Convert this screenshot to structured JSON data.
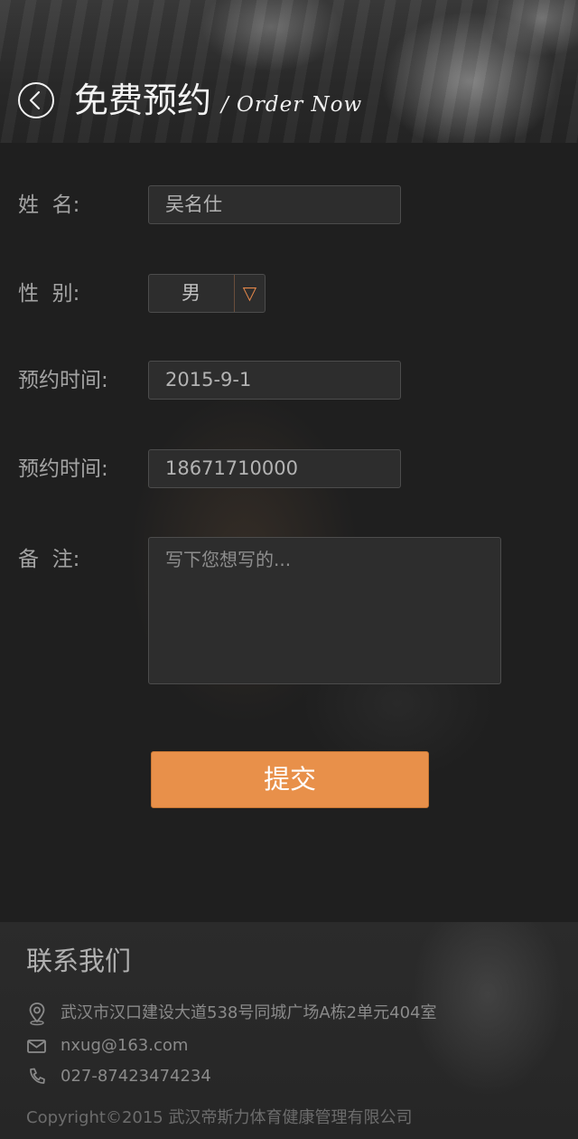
{
  "header": {
    "title": "免费预约",
    "subtitle": "/ Order Now"
  },
  "form": {
    "name": {
      "label": "姓  名:",
      "value": "吴名仕"
    },
    "gender": {
      "label": "性  别:",
      "value": "男",
      "toggle_glyph": "▽"
    },
    "date": {
      "label": "预约时间:",
      "value": "2015-9-1"
    },
    "phone": {
      "label": "预约时间:",
      "value": "18671710000"
    },
    "notes": {
      "label": "备  注:",
      "placeholder": "写下您想写的..."
    },
    "submit_label": "提交"
  },
  "footer": {
    "title": "联系我们",
    "address": "武汉市汉口建设大道538号同城广场A栋2单元404室",
    "email": "nxug@163.com",
    "phone": "027-87423474234",
    "copyright": "Copyright©2015 武汉帝斯力体育健康管理有限公司"
  },
  "colors": {
    "accent": "#e8904a",
    "background": "#1f1f1f",
    "field_bg": "#2d2d2d"
  },
  "icons": {
    "back": "chevron-left-circle-icon",
    "location": "location-pin-icon",
    "email": "envelope-icon",
    "phone": "phone-icon"
  }
}
